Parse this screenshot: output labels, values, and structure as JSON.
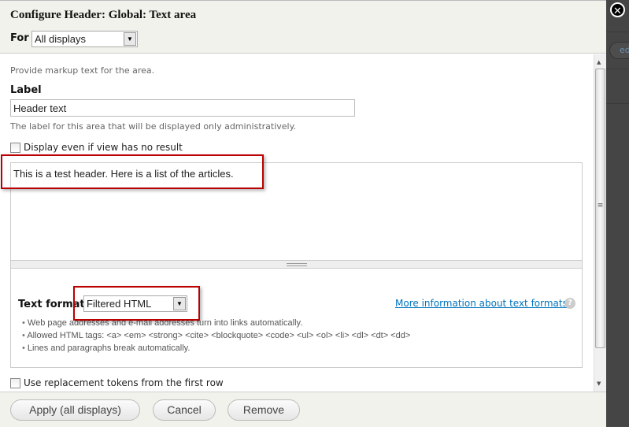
{
  "dialog": {
    "title": "Configure Header: Global: Text area",
    "for_label": "For",
    "for_value": "All displays",
    "close_icon": "close-icon"
  },
  "form": {
    "description": "Provide markup text for the area.",
    "label_heading": "Label",
    "label_value": "Header text",
    "label_help": "The label for this area that will be displayed only administratively.",
    "empty_checkbox_label": "Display even if view has no result",
    "empty_checked": false,
    "body_text": "This is a test header. Here is a list of the articles.",
    "text_format_label": "Text format",
    "text_format_value": "Filtered HTML",
    "more_info_link": "More information about text formats",
    "format_tips": [
      "Web page addresses and e-mail addresses turn into links automatically.",
      "Allowed HTML tags: <a> <em> <strong> <cite> <blockquote> <code> <ul> <ol> <li> <dl> <dt> <dd>",
      "Lines and paragraphs break automatically."
    ],
    "tokens_checkbox_label": "Use replacement tokens from the first row",
    "tokens_checked": false
  },
  "footer": {
    "apply": "Apply (all displays)",
    "cancel": "Cancel",
    "remove": "Remove"
  },
  "background": {
    "pill_text": "ed"
  },
  "colors": {
    "highlight": "#bb0000",
    "link": "#0074bd"
  }
}
